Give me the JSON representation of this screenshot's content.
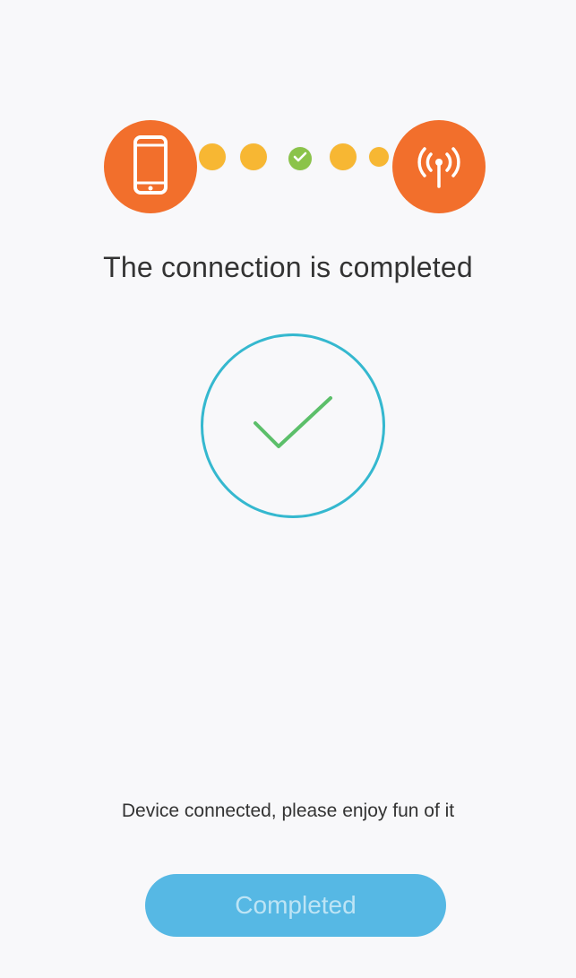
{
  "header": {
    "icons": {
      "left": "phone-icon",
      "right": "wifi-signal-icon",
      "middle": "check-icon"
    },
    "colors": {
      "node": "#f26f2c",
      "dot": "#f7b733",
      "check_dot": "#8bc34a"
    }
  },
  "status": {
    "title": "The connection is completed",
    "icon": "success-check-icon",
    "ring_color": "#35b8cf",
    "check_color": "#5cbf6a"
  },
  "footer": {
    "message": "Device connected, please enjoy fun of it",
    "button_label": "Completed",
    "button_color": "#56b8e4"
  }
}
